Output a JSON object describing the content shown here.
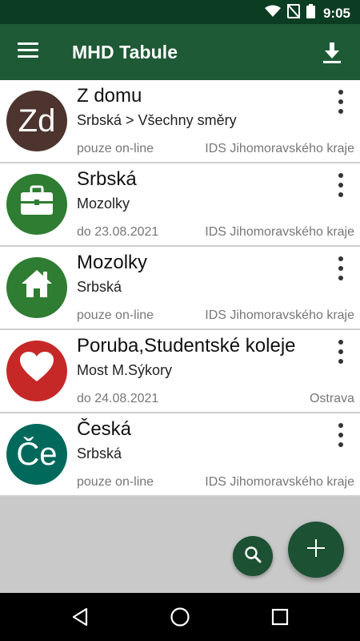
{
  "status_bar": {
    "time": "9:05",
    "icons": [
      "wifi-icon",
      "no-signal-icon",
      "battery-icon"
    ]
  },
  "app_bar": {
    "title": "MHD Tabule",
    "menu_icon": "menu-icon",
    "action_icon": "download-icon",
    "background": "#1e5a36"
  },
  "items": [
    {
      "avatar_text": "Zd",
      "avatar_icon": "",
      "avatar_color": "#4e342e",
      "title": "Z domu",
      "subtitle": "Srbská > Všechny směry",
      "validity": "pouze on-line",
      "region": "IDS Jihomoravského kraje"
    },
    {
      "avatar_text": "",
      "avatar_icon": "briefcase-icon",
      "avatar_color": "#2e7d32",
      "title": "Srbská",
      "subtitle": "Mozolky",
      "validity": "do 23.08.2021",
      "region": "IDS Jihomoravského kraje"
    },
    {
      "avatar_text": "",
      "avatar_icon": "home-icon",
      "avatar_color": "#2e7d32",
      "title": "Mozolky",
      "subtitle": "Srbská",
      "validity": "pouze on-line",
      "region": "IDS Jihomoravského kraje"
    },
    {
      "avatar_text": "",
      "avatar_icon": "heart-icon",
      "avatar_color": "#c62828",
      "title": "Poruba,Studentské koleje",
      "subtitle": "Most M.Sýkory",
      "validity": "do 24.08.2021",
      "region": "Ostrava"
    },
    {
      "avatar_text": "Če",
      "avatar_icon": "",
      "avatar_color": "#00695c",
      "title": "Česká",
      "subtitle": "Srbská",
      "validity": "pouze on-line",
      "region": "IDS Jihomoravského kraje"
    }
  ],
  "fabs": {
    "search_icon": "search-icon",
    "add_icon": "plus-icon",
    "color": "#1c5133"
  },
  "nav_bar": {
    "icons": [
      "back-icon",
      "home-circle-icon",
      "recents-icon"
    ]
  }
}
